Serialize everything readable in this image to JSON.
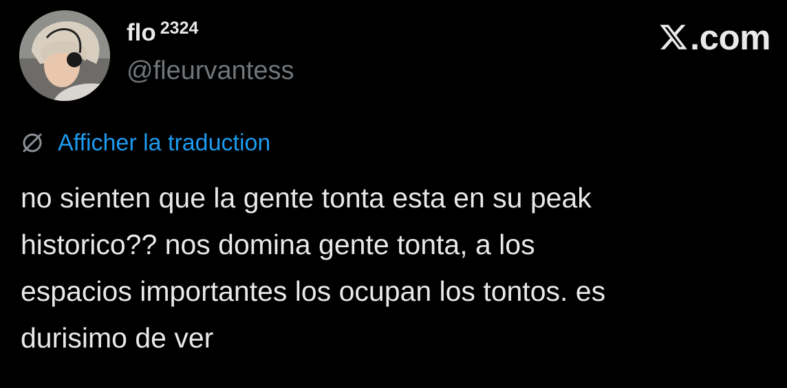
{
  "author": {
    "display_name": "flo",
    "display_name_suffix": "2324",
    "handle": "@fleurvantess",
    "avatar_icon": "profile-photo"
  },
  "brand": {
    "logo_icon": "x-logo-icon",
    "text": ".com"
  },
  "translate": {
    "icon": "globe-icon",
    "label": "Afficher la traduction",
    "color": "#1d9bf0"
  },
  "tweet": {
    "lines": [
      "no sienten que la gente tonta esta en su peak",
      "historico?? nos domina gente tonta, a los",
      "espacios importantes los ocupan los tontos. es",
      "durisimo de ver"
    ]
  },
  "colors": {
    "background": "#000000",
    "primary_text": "#e7e9ea",
    "secondary_text": "#71767b",
    "link": "#1d9bf0"
  }
}
